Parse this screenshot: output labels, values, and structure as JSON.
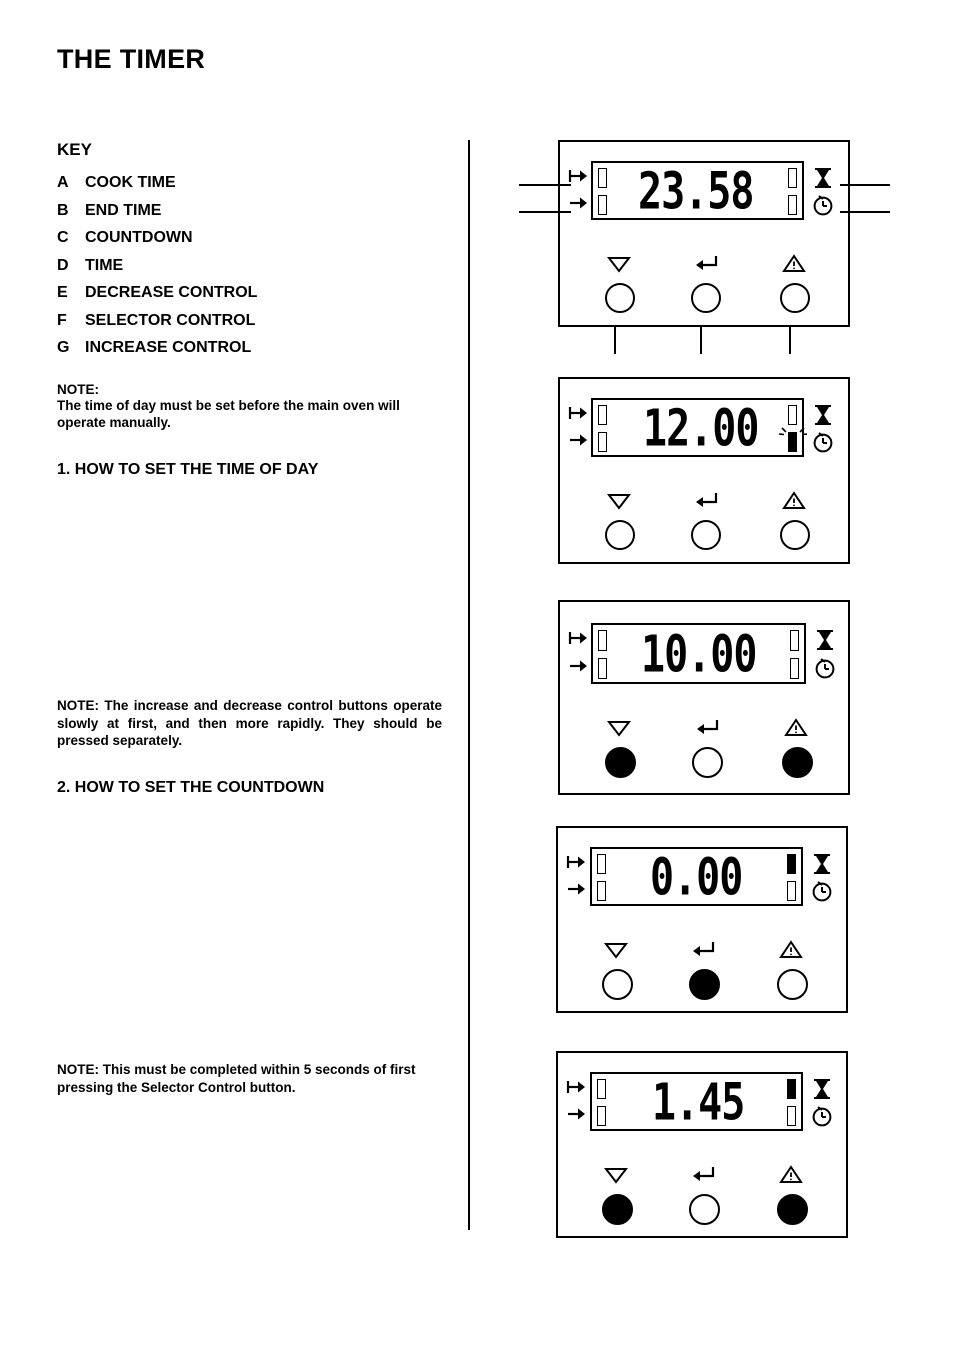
{
  "document": {
    "title": "THE TIMER",
    "key_heading": "KEY",
    "key_items": [
      {
        "letter": "A",
        "label": "COOK TIME"
      },
      {
        "letter": "B",
        "label": "END TIME"
      },
      {
        "letter": "C",
        "label": "COUNTDOWN"
      },
      {
        "letter": "D",
        "label": "TIME"
      },
      {
        "letter": "E",
        "label": "DECREASE CONTROL"
      },
      {
        "letter": "F",
        "label": "SELECTOR CONTROL"
      },
      {
        "letter": "G",
        "label": "INCREASE CONTROL"
      }
    ],
    "note1_line1": "NOTE:",
    "note1_line2": "The time of day must be set before the main oven will operate manually.",
    "section1_heading": "1.  HOW TO SET THE TIME OF DAY",
    "note2": "NOTE:    The increase and decrease control buttons operate slowly at first, and then more rapidly.  They should be pressed separately.",
    "section2_heading": "2.  HOW TO SET THE COUNTDOWN",
    "note3": "NOTE:  This must be completed within 5 seconds of first pressing the Selector Control button."
  },
  "panels": [
    {
      "name": "panel-1",
      "display_value": "23.58",
      "blink_marker": false,
      "buttons": [
        {
          "name": "decrease-control",
          "icon": "triangle-down-icon",
          "pressed": false
        },
        {
          "name": "selector-control",
          "icon": "return-arrow-icon",
          "pressed": false
        },
        {
          "name": "increase-control",
          "icon": "triangle-up-icon",
          "pressed": false
        }
      ],
      "indicators": {
        "cook_time": "cook-time-arrow-icon",
        "end_time": "end-time-arrow-icon",
        "countdown": "hourglass-icon",
        "time": "clock-icon"
      },
      "has_leaders": true
    },
    {
      "name": "panel-2",
      "display_value": "12.00",
      "blink_marker": true,
      "buttons": [
        {
          "name": "decrease-control",
          "icon": "triangle-down-icon",
          "pressed": false
        },
        {
          "name": "selector-control",
          "icon": "return-arrow-icon",
          "pressed": false
        },
        {
          "name": "increase-control",
          "icon": "triangle-up-icon",
          "pressed": false
        }
      ],
      "indicators": {
        "cook_time": "cook-time-arrow-icon",
        "end_time": "end-time-arrow-icon",
        "countdown": "hourglass-icon",
        "time": "clock-icon"
      },
      "has_leaders": false
    },
    {
      "name": "panel-3",
      "display_value": "10.00",
      "blink_marker": false,
      "buttons": [
        {
          "name": "decrease-control",
          "icon": "triangle-down-icon",
          "pressed": true
        },
        {
          "name": "selector-control",
          "icon": "return-arrow-icon",
          "pressed": false
        },
        {
          "name": "increase-control",
          "icon": "triangle-up-icon",
          "pressed": true
        }
      ],
      "indicators": {
        "cook_time": "cook-time-arrow-icon",
        "end_time": "end-time-arrow-icon",
        "countdown": "hourglass-icon",
        "time": "clock-icon"
      },
      "has_leaders": false
    },
    {
      "name": "panel-4",
      "display_value": "0.00",
      "blink_marker": false,
      "countdown_active": true,
      "buttons": [
        {
          "name": "decrease-control",
          "icon": "triangle-down-icon",
          "pressed": false
        },
        {
          "name": "selector-control",
          "icon": "return-arrow-icon",
          "pressed": true
        },
        {
          "name": "increase-control",
          "icon": "triangle-up-icon",
          "pressed": false
        }
      ],
      "indicators": {
        "cook_time": "cook-time-arrow-icon",
        "end_time": "end-time-arrow-icon",
        "countdown": "hourglass-icon",
        "time": "clock-icon"
      },
      "has_leaders": false
    },
    {
      "name": "panel-5",
      "display_value": "1.45",
      "blink_marker": false,
      "countdown_active": true,
      "buttons": [
        {
          "name": "decrease-control",
          "icon": "triangle-down-icon",
          "pressed": true
        },
        {
          "name": "selector-control",
          "icon": "return-arrow-icon",
          "pressed": false
        },
        {
          "name": "increase-control",
          "icon": "triangle-up-icon",
          "pressed": true
        }
      ],
      "indicators": {
        "cook_time": "cook-time-arrow-icon",
        "end_time": "end-time-arrow-icon",
        "countdown": "hourglass-icon",
        "time": "clock-icon"
      },
      "has_leaders": false
    }
  ]
}
